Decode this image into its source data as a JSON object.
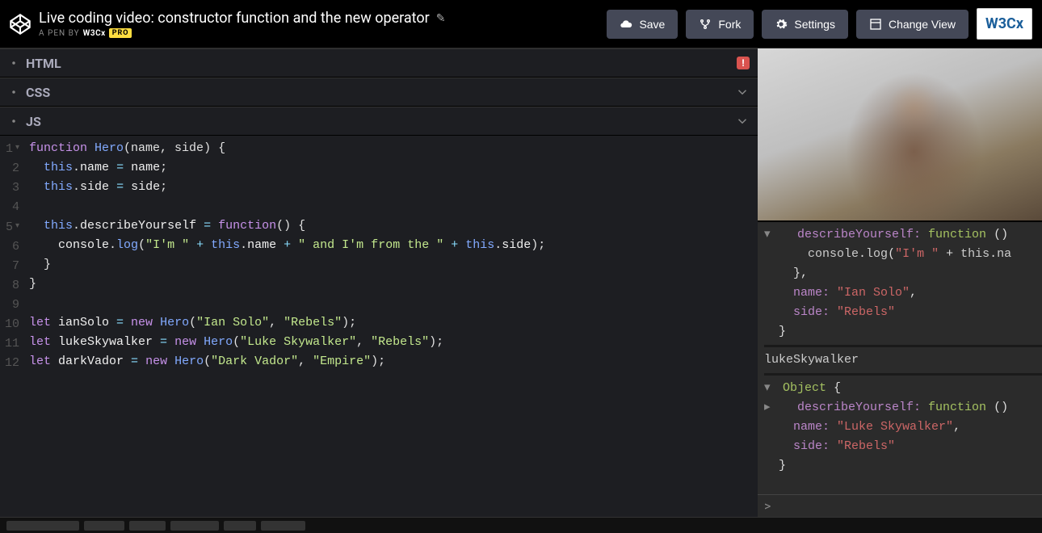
{
  "header": {
    "title": "Live coding video: constructor function and the new operator",
    "a_pen_by": "A PEN BY",
    "author": "W3Cx",
    "pro": "PRO",
    "buttons": {
      "save": "Save",
      "fork": "Fork",
      "settings": "Settings",
      "change_view": "Change View"
    },
    "brand": "W3Cx"
  },
  "panels": {
    "html": "HTML",
    "css": "CSS",
    "js": "JS",
    "error": "!"
  },
  "code": {
    "lines": [
      {
        "n": "1",
        "fold": true
      },
      {
        "n": "2"
      },
      {
        "n": "3"
      },
      {
        "n": "4"
      },
      {
        "n": "5",
        "fold": true
      },
      {
        "n": "6"
      },
      {
        "n": "7"
      },
      {
        "n": "8"
      },
      {
        "n": "9"
      },
      {
        "n": "10"
      },
      {
        "n": "11"
      },
      {
        "n": "12"
      }
    ],
    "l1_kw": "function",
    "l1_fn": "Hero",
    "l1_args": "(name, side) {",
    "l2_this": "this",
    "l2_dot": ".",
    "l2_prop": "name",
    "l2_eq": " = ",
    "l2_val": "name",
    "l2_end": ";",
    "l3_this": "this",
    "l3_dot": ".",
    "l3_prop": "side",
    "l3_eq": " = ",
    "l3_val": "side",
    "l3_end": ";",
    "l5_this": "this",
    "l5_dot": ".",
    "l5_prop": "describeYourself",
    "l5_eq": " = ",
    "l5_kw": "function",
    "l5_rest": "() {",
    "l6_a": "console",
    "l6_b": ".",
    "l6_c": "log",
    "l6_d": "(",
    "l6_s1": "\"I'm \"",
    "l6_p1": " + ",
    "l6_t1": "this",
    "l6_d1": ".",
    "l6_n1": "name",
    "l6_p2": " + ",
    "l6_s2": "\" and I'm from the \"",
    "l6_p3": " + ",
    "l6_t2": "this",
    "l6_d2": ".",
    "l6_n2": "side",
    "l6_e": ");",
    "l7": "  }",
    "l8": "}",
    "l10_let": "let",
    "l10_var": " ianSolo ",
    "l10_eq": "= ",
    "l10_new": "new",
    "l10_cls": " Hero",
    "l10_op": "(",
    "l10_s1": "\"Ian Solo\"",
    "l10_c": ", ",
    "l10_s2": "\"Rebels\"",
    "l10_cl": ");",
    "l11_let": "let",
    "l11_var": " lukeSkywalker ",
    "l11_eq": "= ",
    "l11_new": "new",
    "l11_cls": " Hero",
    "l11_op": "(",
    "l11_s1": "\"Luke Skywalker\"",
    "l11_c": ", ",
    "l11_s2": "\"Rebels\"",
    "l11_cl": ");",
    "l12_let": "let",
    "l12_var": " darkVador ",
    "l12_eq": "= ",
    "l12_new": "new",
    "l12_cls": " Hero",
    "l12_op": "(",
    "l12_s1": "\"Dark Vador\"",
    "l12_c": ", ",
    "l12_s2": "\"Empire\"",
    "l12_cl": ");"
  },
  "console": {
    "obj1": {
      "dy": "describeYourself: ",
      "fn": "function ",
      "paren": "()",
      "log": "console",
      "dot": ".",
      "logfn": "log",
      "open": "(",
      "s": "\"I'm \"",
      "plus": " + ",
      "this": "this",
      "d": ".",
      "na": "na",
      "close": "},",
      "name_k": "name: ",
      "name_v": "\"Ian Solo\"",
      "comma": ",",
      "side_k": "side: ",
      "side_v": "\"Rebels\"",
      "end": "}"
    },
    "var": "lukeSkywalker",
    "obj2": {
      "head": "Object ",
      "brace": "{",
      "dy": "describeYourself: ",
      "fn": "function ",
      "paren": "()",
      "name_k": "name: ",
      "name_v": "\"Luke Skywalker\"",
      "comma": ",",
      "side_k": "side: ",
      "side_v": "\"Rebels\"",
      "end": "}"
    },
    "prompt": ">"
  }
}
